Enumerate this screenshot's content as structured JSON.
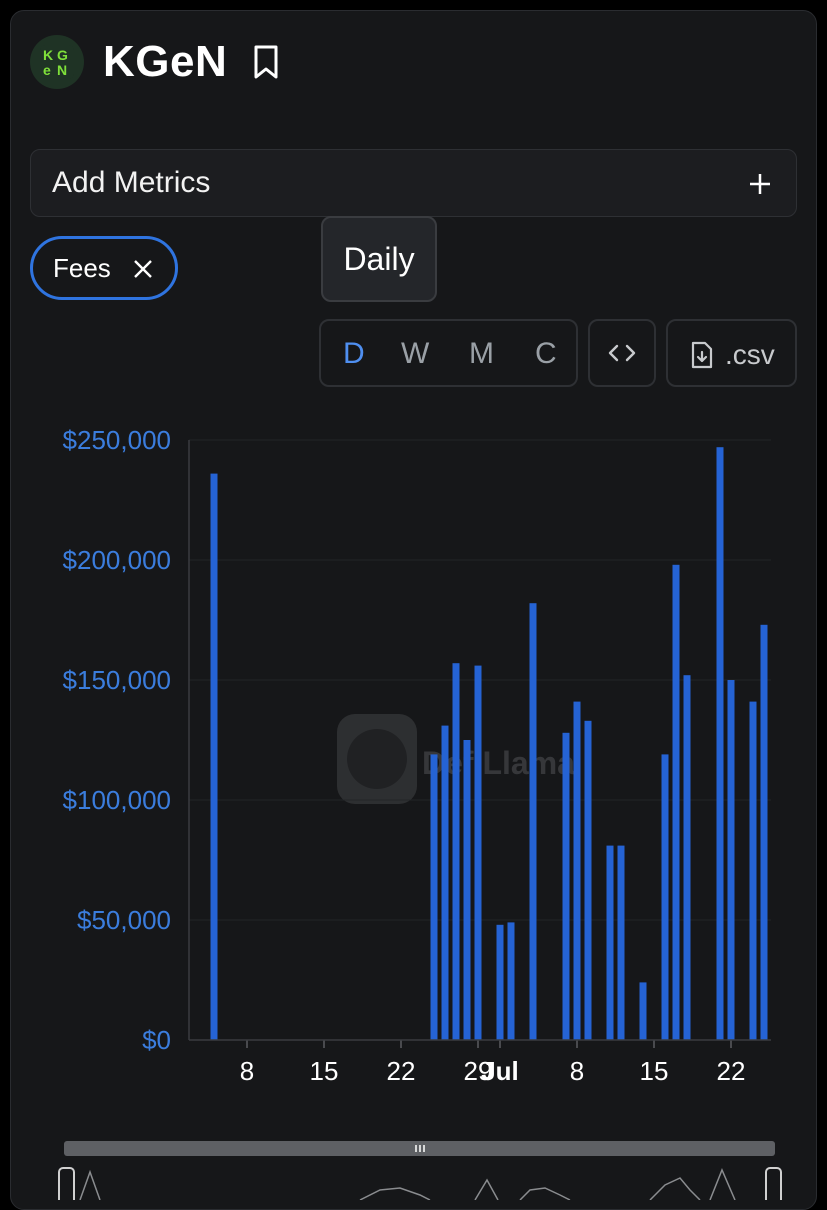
{
  "header": {
    "title": "KGeN",
    "logo_text": "KGeN",
    "logo_icon": "kgen-logo-icon",
    "bookmark_icon": "bookmark-icon"
  },
  "add_metrics": {
    "label": "Add Metrics",
    "icon": "plus-icon"
  },
  "metric_chip": {
    "label": "Fees",
    "icon": "close-icon"
  },
  "tooltip": {
    "text": "Daily"
  },
  "interval_options": [
    {
      "label": "D",
      "active": true
    },
    {
      "label": "W",
      "active": false
    },
    {
      "label": "M",
      "active": false
    },
    {
      "label": "C",
      "active": false
    }
  ],
  "embed_button": {
    "icon": "code-icon"
  },
  "csv_button": {
    "label": ".csv",
    "icon": "download-file-icon"
  },
  "watermark": {
    "text": "DefiLlama"
  },
  "colors": {
    "accent": "#2f74e0",
    "bar": "#2563d4",
    "axis_label": "#3b7ddd",
    "background": "#161719"
  },
  "chart_data": {
    "type": "bar",
    "series": [
      {
        "name": "Fees"
      }
    ],
    "x_ticks": [
      "8",
      "15",
      "22",
      "29",
      "Jul",
      "8",
      "15",
      "22"
    ],
    "y_ticks": [
      "$0",
      "$50,000",
      "$100,000",
      "$150,000",
      "$200,000",
      "$250,000"
    ],
    "ylim": [
      0,
      250000
    ],
    "x": [
      "Jun 5",
      "Jun 25",
      "Jun 26",
      "Jun 27",
      "Jun 28",
      "Jun 29",
      "Jul 1",
      "Jul 2",
      "Jul 4",
      "Jul 7",
      "Jul 8",
      "Jul 9",
      "Jul 11",
      "Jul 12",
      "Jul 14",
      "Jul 16",
      "Jul 17",
      "Jul 18",
      "Jul 21",
      "Jul 22",
      "Jul 24",
      "Jul 25"
    ],
    "values": [
      236000,
      119000,
      131000,
      157000,
      125000,
      156000,
      48000,
      49000,
      182000,
      128000,
      141000,
      133000,
      81000,
      81000,
      24000,
      119000,
      198000,
      152000,
      247000,
      150000,
      141000,
      173000
    ]
  }
}
